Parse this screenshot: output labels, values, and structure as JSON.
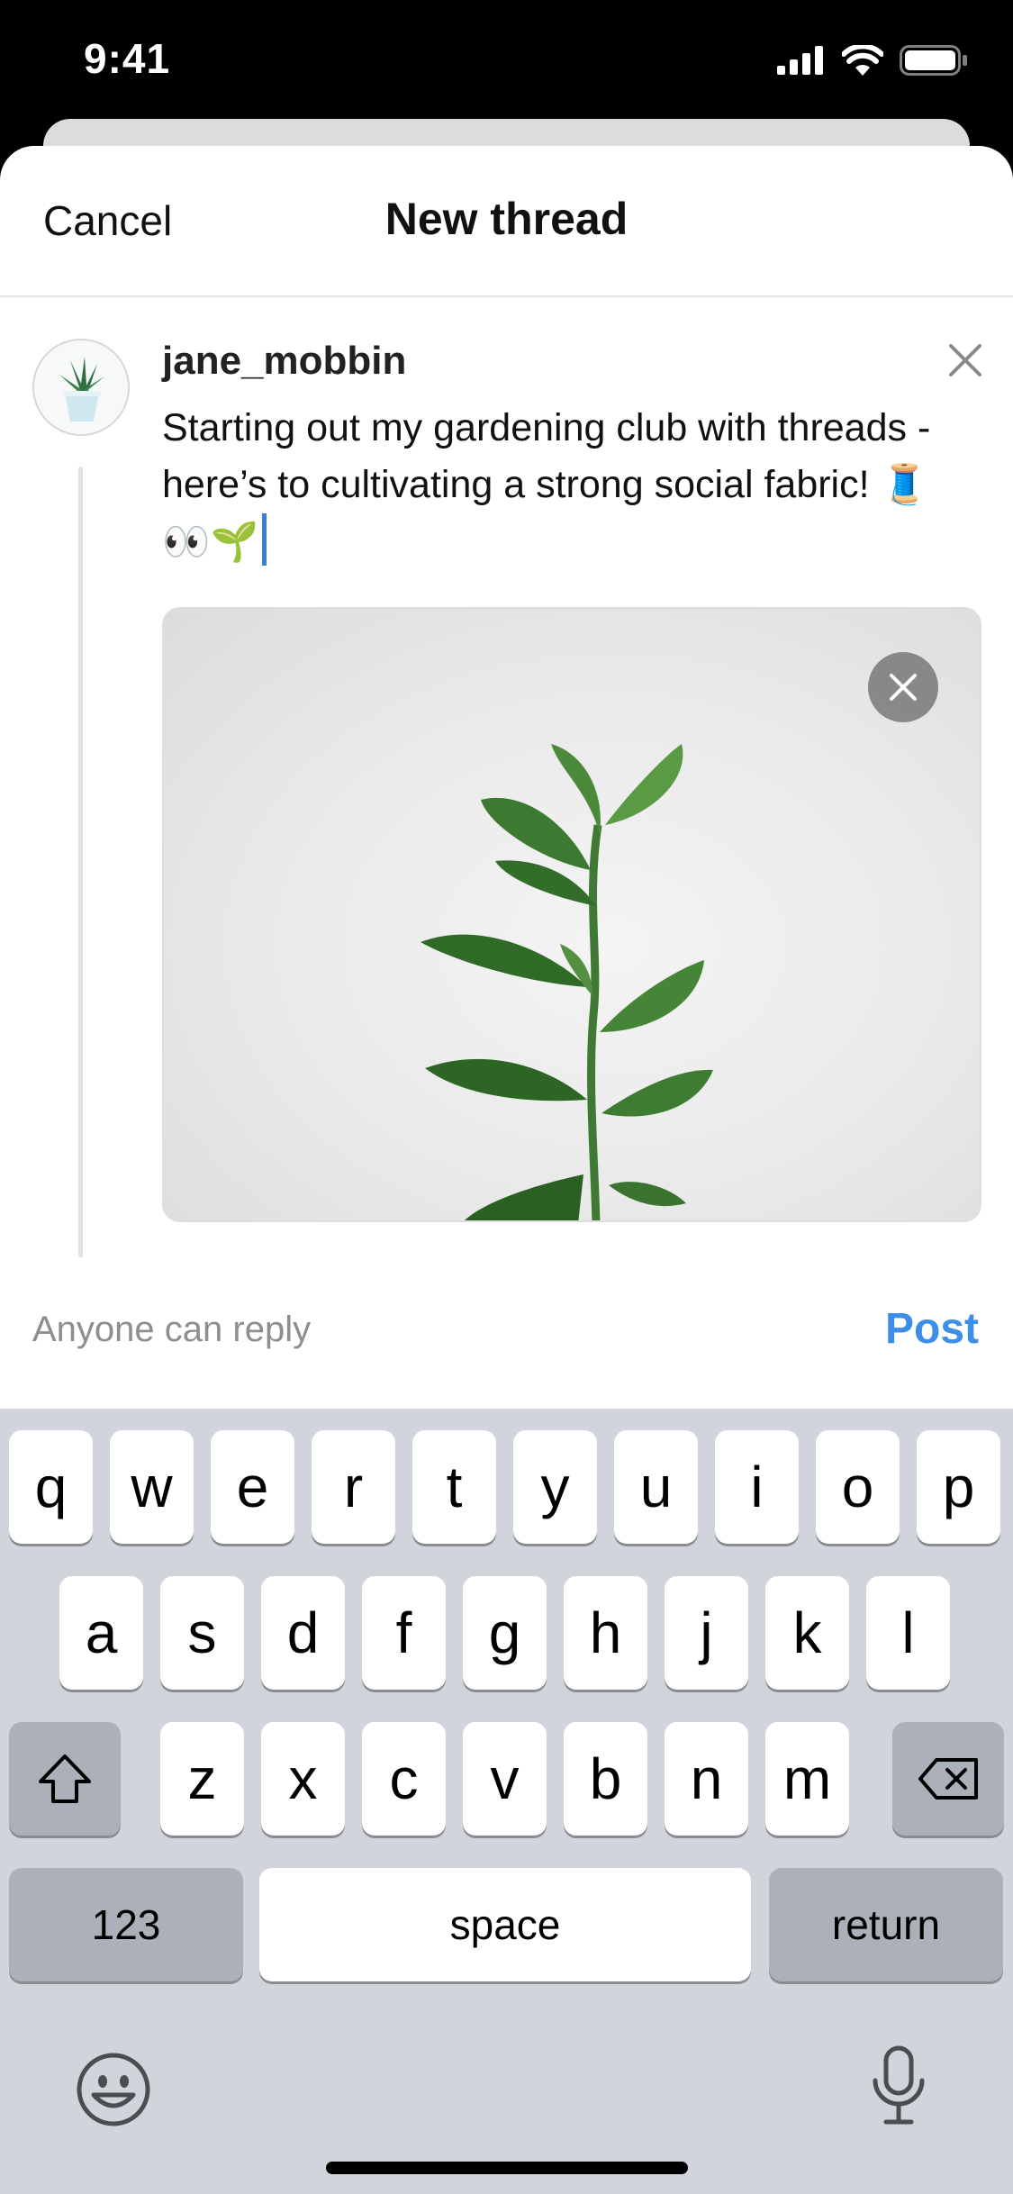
{
  "status_bar": {
    "time": "9:41"
  },
  "nav": {
    "cancel_label": "Cancel",
    "title": "New thread"
  },
  "post": {
    "username": "jane_mobbin",
    "text": "Starting out my gardening club with threads - here’s to cultivating a strong social fabric! 🧵👀🌱"
  },
  "footer": {
    "reply_setting": "Anyone can reply",
    "post_label": "Post"
  },
  "keyboard": {
    "row1": [
      "q",
      "w",
      "e",
      "r",
      "t",
      "y",
      "u",
      "i",
      "o",
      "p"
    ],
    "row2": [
      "a",
      "s",
      "d",
      "f",
      "g",
      "h",
      "j",
      "k",
      "l"
    ],
    "row3": [
      "z",
      "x",
      "c",
      "v",
      "b",
      "n",
      "m"
    ],
    "numbers_label": "123",
    "space_label": "space",
    "return_label": "return"
  },
  "colors": {
    "accent": "#3d8ee8",
    "caret": "#3a7fe0",
    "keyboard_bg": "#d1d4da"
  },
  "icons": [
    "signal-icon",
    "wifi-icon",
    "battery-icon",
    "close-icon",
    "remove-media-icon",
    "shift-icon",
    "backspace-icon",
    "emoji-icon",
    "microphone-icon"
  ]
}
